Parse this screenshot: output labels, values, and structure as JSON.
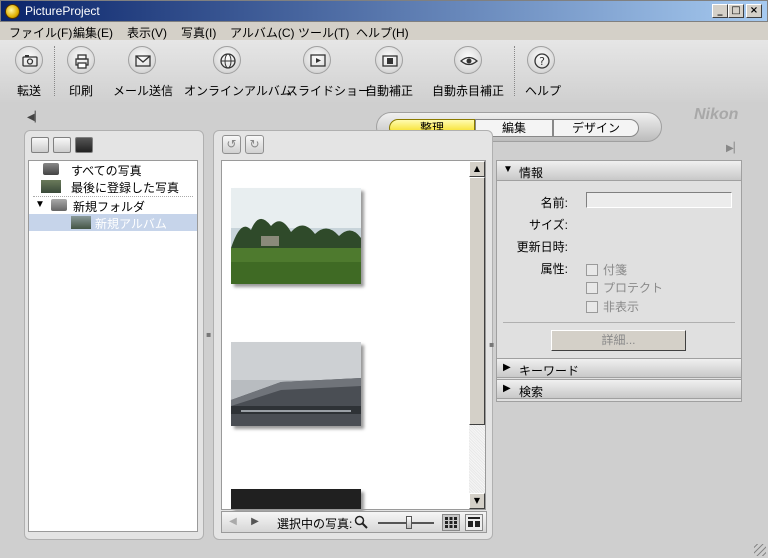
{
  "window": {
    "title": "PictureProject"
  },
  "menu": [
    "ファイル(F)",
    "編集(E)",
    "表示(V)",
    "写真(I)",
    "アルバム(C)",
    "ツール(T)",
    "ヘルプ(H)"
  ],
  "toolbar": {
    "transfer": "転送",
    "print": "印刷",
    "email": "メール送信",
    "online_album": "オンラインアルバム",
    "slideshow": "スライドショー",
    "auto_enhance": "自動補正",
    "auto_redeye": "自動赤目補正",
    "help": "ヘルプ"
  },
  "brand": "Nikon",
  "modes": {
    "organize": "整理",
    "edit": "編集",
    "design": "デザイン",
    "active": "整理"
  },
  "tree": {
    "all_photos": "すべての写真",
    "last_registered": "最後に登録した写真",
    "new_folder": "新規フォルダ",
    "new_album": "新規アルバム"
  },
  "viewer": {
    "selected_label": "選択中の写真:",
    "zoom_level": 0.55
  },
  "info": {
    "header": "情報",
    "name_label": "名前:",
    "size_label": "サイズ:",
    "modified_label": "更新日時:",
    "attributes_label": "属性:",
    "attr_sticky": "付箋",
    "attr_protect": "プロテクト",
    "attr_hidden": "非表示",
    "detail_button": "詳細..."
  },
  "keyword": {
    "header": "キーワード"
  },
  "search": {
    "header": "検索"
  },
  "colors": {
    "title_start": "#0a246a",
    "title_end": "#a6caf0",
    "active_tab": "#f4d800",
    "selection": "#c6d4ea"
  }
}
